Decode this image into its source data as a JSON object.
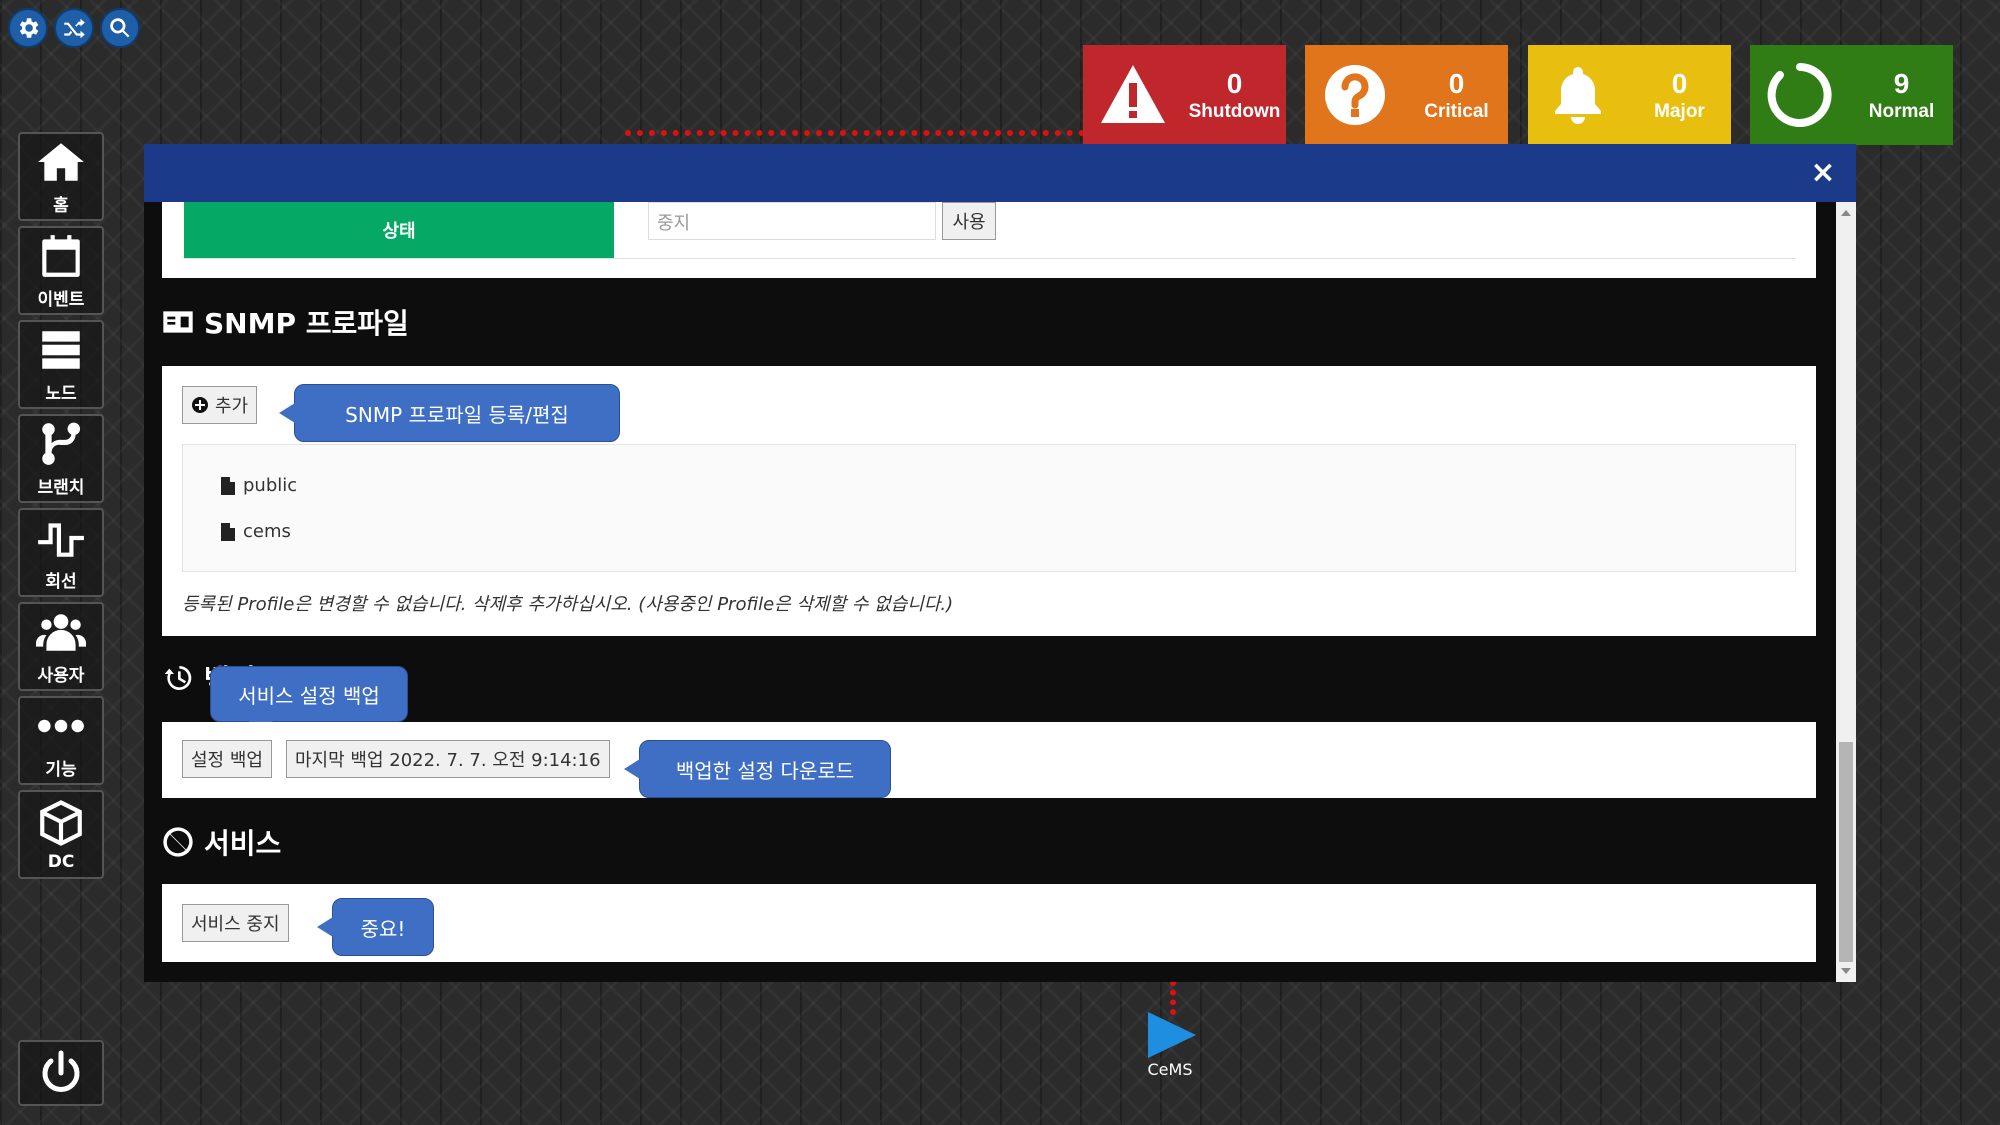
{
  "colors": {
    "shutdown": "#c0272d",
    "critical": "#e0751c",
    "major": "#e8bf0f",
    "normal": "#2f7d14",
    "modal_header": "#1b3a8a",
    "status_green": "#06a865",
    "tooltip": "#3f6fc4"
  },
  "toolbar": {
    "icons": [
      "gear-icon",
      "shuffle-icon",
      "search-icon"
    ]
  },
  "status_tiles": [
    {
      "icon": "warning-icon",
      "count": "0",
      "label": "Shutdown"
    },
    {
      "icon": "question-icon",
      "count": "0",
      "label": "Critical"
    },
    {
      "icon": "bell-icon",
      "count": "0",
      "label": "Major"
    },
    {
      "icon": "circle-icon",
      "count": "9",
      "label": "Normal"
    }
  ],
  "sidebar": {
    "items": [
      {
        "icon": "home-icon",
        "label": "홈"
      },
      {
        "icon": "calendar-icon",
        "label": "이벤트"
      },
      {
        "icon": "server-icon",
        "label": "노드"
      },
      {
        "icon": "branch-icon",
        "label": "브랜치"
      },
      {
        "icon": "signal-icon",
        "label": "회선"
      },
      {
        "icon": "users-icon",
        "label": "사용자"
      },
      {
        "icon": "more-icon",
        "label": "기능"
      },
      {
        "icon": "cube-icon",
        "label": "DC"
      }
    ],
    "power_icon": "power-icon"
  },
  "background": {
    "cems_label": "CeMS"
  },
  "modal": {
    "close_label": "×",
    "status_section": {
      "status_label": "상태",
      "status_value": "중지",
      "use_button": "사용"
    },
    "snmp": {
      "title": "SNMP 프로파일",
      "add_button": "추가",
      "tooltip": "SNMP 프로파일 등록/편집",
      "profiles": [
        "public",
        "cems"
      ],
      "note": "등록된 Profile은 변경할 수 없습니다. 삭제후 추가하십시오. (사용중인 Profile은 삭제할 수 없습니다.)"
    },
    "backup": {
      "title": "백업",
      "tooltip": "서비스 설정 백업",
      "backup_button": "설정 백업",
      "last_backup": "마지막 백업 2022. 7. 7. 오전 9:14:16",
      "download_tooltip": "백업한 설정 다운로드"
    },
    "service": {
      "title": "서비스",
      "stop_button": "서비스 중지",
      "tooltip": "중요!"
    }
  }
}
